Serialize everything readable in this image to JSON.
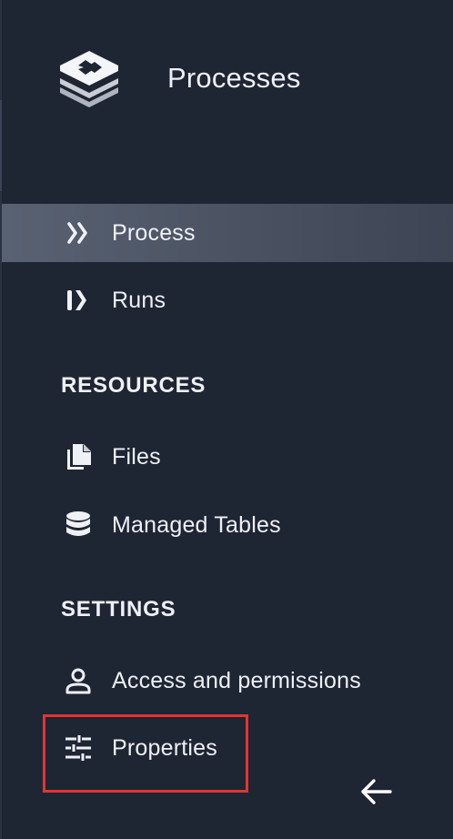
{
  "header": {
    "app_title": "Processes",
    "logo_icon": "stacked-layers-logo-icon"
  },
  "nav": {
    "items": [
      {
        "label": "Process",
        "icon": "double-chevron-right-icon",
        "active": true
      },
      {
        "label": "Runs",
        "icon": "runs-icon",
        "active": false
      }
    ]
  },
  "resources": {
    "heading": "RESOURCES",
    "items": [
      {
        "label": "Files",
        "icon": "files-icon"
      },
      {
        "label": "Managed Tables",
        "icon": "database-icon"
      }
    ]
  },
  "settings": {
    "heading": "SETTINGS",
    "items": [
      {
        "label": "Access and permissions",
        "icon": "person-icon"
      },
      {
        "label": "Properties",
        "icon": "sliders-icon",
        "highlighted": true
      }
    ]
  },
  "footer": {
    "collapse_icon": "arrow-left-icon"
  },
  "colors": {
    "background": "#1e2533",
    "text": "#eef1f6",
    "active_item": "#596272",
    "highlight_border": "#e8322c"
  }
}
